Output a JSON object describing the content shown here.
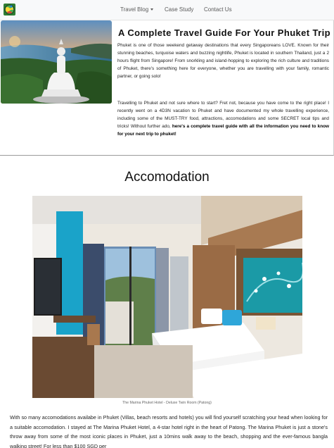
{
  "navbar": {
    "logo_icon": "globe-logo-icon",
    "items": [
      {
        "label": "Travel Blog",
        "has_dropdown": true
      },
      {
        "label": "Case Study",
        "has_dropdown": false
      },
      {
        "label": "Contact Us",
        "has_dropdown": false
      }
    ]
  },
  "hero": {
    "title": "A Complete Travel Guide For Your Phuket Trip",
    "paragraph1": "Phuket is one of those weekend getaway destinations that every Singaporeans LOVE. Known for their stunning beaches, turquoise waters and buzzing nightlife, Phuket is located in southern Thailand, just a 2 hours flight from Singapore! From snorkling and island-hopping to exploring the rich culture and traditions of Phuket, there's something here for everyone, whether you are travelling with your family, romantic partner, or going solo!",
    "paragraph2_text": "Travelling to Phuket and not sure where to start? Fret not, because you have come to the right place! I recently went on a 4D3N vacation to Phuket and have documented my whole travelling experience, including some of the MUST-TRY food, attractions, accomodations and some SECRET local tips and tricks! Without further ado, ",
    "paragraph2_bold": "here's a complete travel guide with all the information you need to know for your next trip to phuket!"
  },
  "accommodation": {
    "heading": "Accomodation",
    "caption": "The Marina Phuket Hotel - Deluxe Twin Room (Patong)",
    "body": "With so many accomodations availabe in Phuket (Villas, beach resorts and hotels) you will find yourself scratching your head when looking for a suitable accomodation. I stayed at The Marina Phuket Hotel, a 4-star hotel right in the heart of Patong. The Marina Phuket is just a stone's throw away from some of the most iconic places in Phuket, just a 10mins walk away to the beach, shopping and the ever-famous bangla walking street! For less than $100 SGD per"
  },
  "colors": {
    "navbar_bg": "#f8f9fa",
    "text": "#212529",
    "accent_wall": "#1aa3c9"
  }
}
